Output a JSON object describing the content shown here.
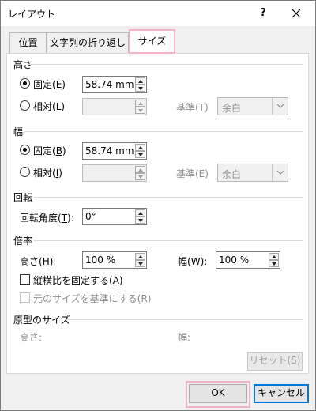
{
  "window": {
    "title": "レイアウト",
    "help_label": "?"
  },
  "tabs": [
    {
      "label": "位置"
    },
    {
      "label": "文字列の折り返し"
    },
    {
      "label": "サイズ",
      "active": true
    }
  ],
  "height": {
    "section_label": "高さ",
    "absolute": {
      "label": "固定(",
      "accel": "E",
      "tail": ")",
      "value": "58.74 mm",
      "selected": true
    },
    "relative": {
      "label": "相対(",
      "accel": "L",
      "tail": ")",
      "value": "",
      "selected": false
    },
    "relative_to_label": "基準(T)",
    "relative_to_value": "余白"
  },
  "width": {
    "section_label": "幅",
    "absolute": {
      "label": "固定(",
      "accel": "B",
      "tail": ")",
      "value": "58.74 mm",
      "selected": true
    },
    "relative": {
      "label": "相対(",
      "accel": "I",
      "tail": ")",
      "value": "",
      "selected": false
    },
    "relative_to_label": "基準(E)",
    "relative_to_value": "余白"
  },
  "rotate": {
    "section_label": "回転",
    "rotation_label": "回転角度(",
    "rotation_accel": "T",
    "rotation_tail": "):",
    "rotation_value": "0°"
  },
  "scale": {
    "section_label": "倍率",
    "height_label": "高さ(",
    "height_accel": "H",
    "height_tail": "):",
    "height_value": "100 %",
    "width_label": "幅(",
    "width_accel": "W",
    "width_tail": "):",
    "width_value": "100 %",
    "lock_aspect_label": "縦横比を固定する(",
    "lock_aspect_accel": "A",
    "lock_aspect_tail": ")",
    "relative_original_label": "元のサイズを基準にする(R)"
  },
  "original": {
    "section_label": "原型のサイズ",
    "height_label": "高さ:",
    "width_label": "幅:",
    "reset_label": "リセット(S)"
  },
  "footer": {
    "ok_label": "OK",
    "cancel_label": "キャンセル"
  },
  "colors": {
    "highlight": "#f2b2c8",
    "default_button_border": "#0078d7"
  }
}
